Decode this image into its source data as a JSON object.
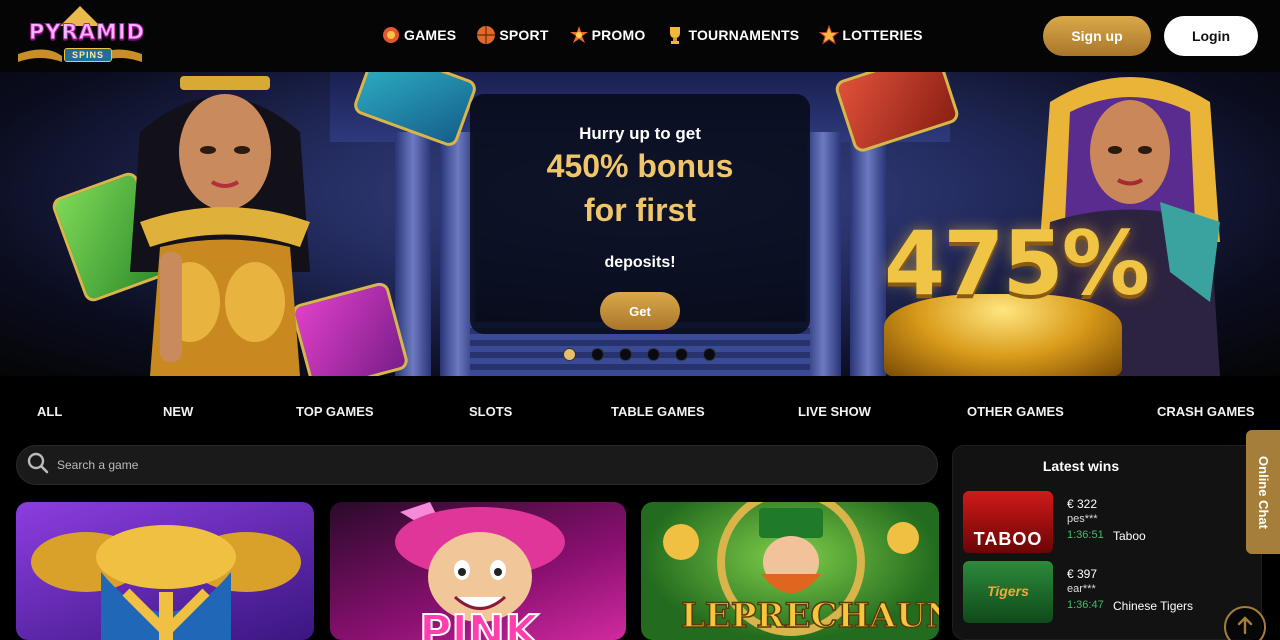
{
  "brand": {
    "name": "PYRAMID",
    "sub": "SPINS"
  },
  "nav": [
    {
      "label": "GAMES",
      "icon": "games-chip-icon"
    },
    {
      "label": "SPORT",
      "icon": "basketball-icon"
    },
    {
      "label": "PROMO",
      "icon": "promo-burst-icon"
    },
    {
      "label": "TOURNAMENTS",
      "icon": "trophy-icon"
    },
    {
      "label": "LOTTERIES",
      "icon": "star-icon"
    }
  ],
  "auth": {
    "signup_label": "Sign up",
    "login_label": "Login"
  },
  "banner": {
    "line1": "Hurry up to get",
    "line2": "450% bonus",
    "line3": "for first",
    "line4": "deposits!",
    "cta_label": "Get",
    "side_percent": "475%",
    "active_slide": 1,
    "slide_count": 6
  },
  "categories": [
    "ALL",
    "NEW",
    "TOP GAMES",
    "SLOTS",
    "TABLE GAMES",
    "LIVE SHOW",
    "OTHER GAMES",
    "CRASH GAMES"
  ],
  "search": {
    "placeholder": "Search a game"
  },
  "games": [
    {
      "title": ""
    },
    {
      "title": "PINK"
    },
    {
      "title": "LEPRECHAUN"
    }
  ],
  "latest_wins": {
    "title": "Latest wins",
    "items": [
      {
        "amount": "€ 322",
        "user": "pes***",
        "time": "1:36:51",
        "game": "Taboo",
        "thumb_label": "TABOO"
      },
      {
        "amount": "€ 397",
        "user": "ear***",
        "time": "1:36:47",
        "game": "Chinese Tigers",
        "thumb_label": "Tigers"
      }
    ]
  },
  "chat": {
    "label": "Online Chat"
  },
  "colors": {
    "gold": "#d9a94a",
    "accent_green": "#3fbf6a",
    "chat_tab": "#a57e3a"
  }
}
